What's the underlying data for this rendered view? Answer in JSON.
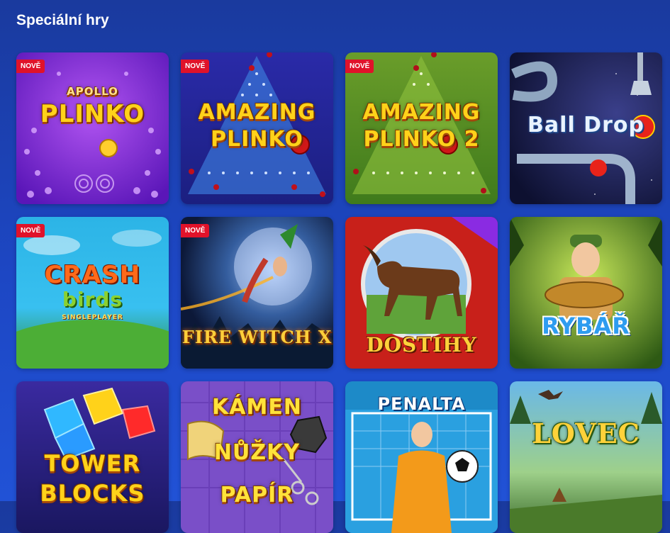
{
  "section": {
    "title": "Speciální hry"
  },
  "badges": {
    "new": "NOVĚ"
  },
  "games": [
    {
      "title_lines": [
        "APOLLO",
        "PLINKO"
      ],
      "new": true
    },
    {
      "title_lines": [
        "AMAZING",
        "PLINKO"
      ],
      "new": true
    },
    {
      "title_lines": [
        "AMAZING",
        "PLINKO 2"
      ],
      "new": true
    },
    {
      "title_lines": [
        "Ball Drop"
      ],
      "new": false
    },
    {
      "title_lines": [
        "CRASH",
        "birds",
        "SINGLEPLAYER"
      ],
      "new": true
    },
    {
      "title_lines": [
        "FIRE WITCH X"
      ],
      "new": true
    },
    {
      "title_lines": [
        "DOSTIHY"
      ],
      "new": false
    },
    {
      "title_lines": [
        "RYBÁŘ"
      ],
      "new": false
    },
    {
      "title_lines": [
        "TOWER",
        "BLOCKS"
      ],
      "new": false
    },
    {
      "title_lines": [
        "KÁMEN",
        "NŮŽKY",
        "PAPÍR"
      ],
      "new": false
    },
    {
      "title_lines": [
        "PENALTA"
      ],
      "new": false
    },
    {
      "title_lines": [
        "LOVEC"
      ],
      "new": false
    }
  ],
  "colors": {
    "background": "#1d47c4",
    "badge": "#e0122a",
    "title_yellow": "#ffd21a"
  }
}
